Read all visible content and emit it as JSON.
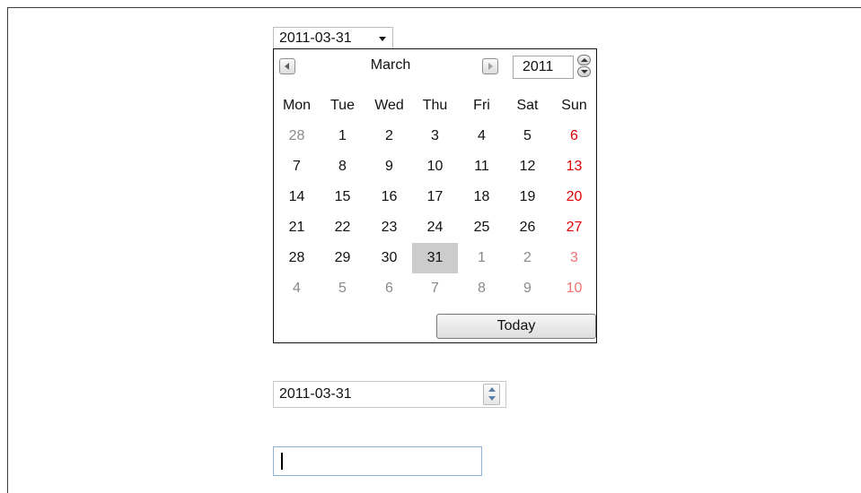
{
  "date_select": {
    "value": "2011-03-31",
    "icon": "chevron-down-icon"
  },
  "calendar": {
    "month": "March",
    "year": "2011",
    "prev_icon": "chevron-left-icon",
    "next_icon": "chevron-right-icon",
    "weekdays": [
      "Mon",
      "Tue",
      "Wed",
      "Thu",
      "Fri",
      "Sat",
      "Sun"
    ],
    "weeks": [
      [
        "28",
        "1",
        "2",
        "3",
        "4",
        "5",
        "6"
      ],
      [
        "7",
        "8",
        "9",
        "10",
        "11",
        "12",
        "13"
      ],
      [
        "14",
        "15",
        "16",
        "17",
        "18",
        "19",
        "20"
      ],
      [
        "21",
        "22",
        "23",
        "24",
        "25",
        "26",
        "27"
      ],
      [
        "28",
        "29",
        "30",
        "31",
        "1",
        "2",
        "3"
      ],
      [
        "4",
        "5",
        "6",
        "7",
        "8",
        "9",
        "10"
      ]
    ],
    "selected_day": "31",
    "today_label": "Today",
    "colors": {
      "weekend": "#e00000",
      "weekend_faded": "#f07070",
      "other_month": "#8a8a8a",
      "selected_bg": "#cccccc"
    }
  },
  "date_input": {
    "value": "2011-03-31"
  },
  "text_input": {
    "value": ""
  }
}
